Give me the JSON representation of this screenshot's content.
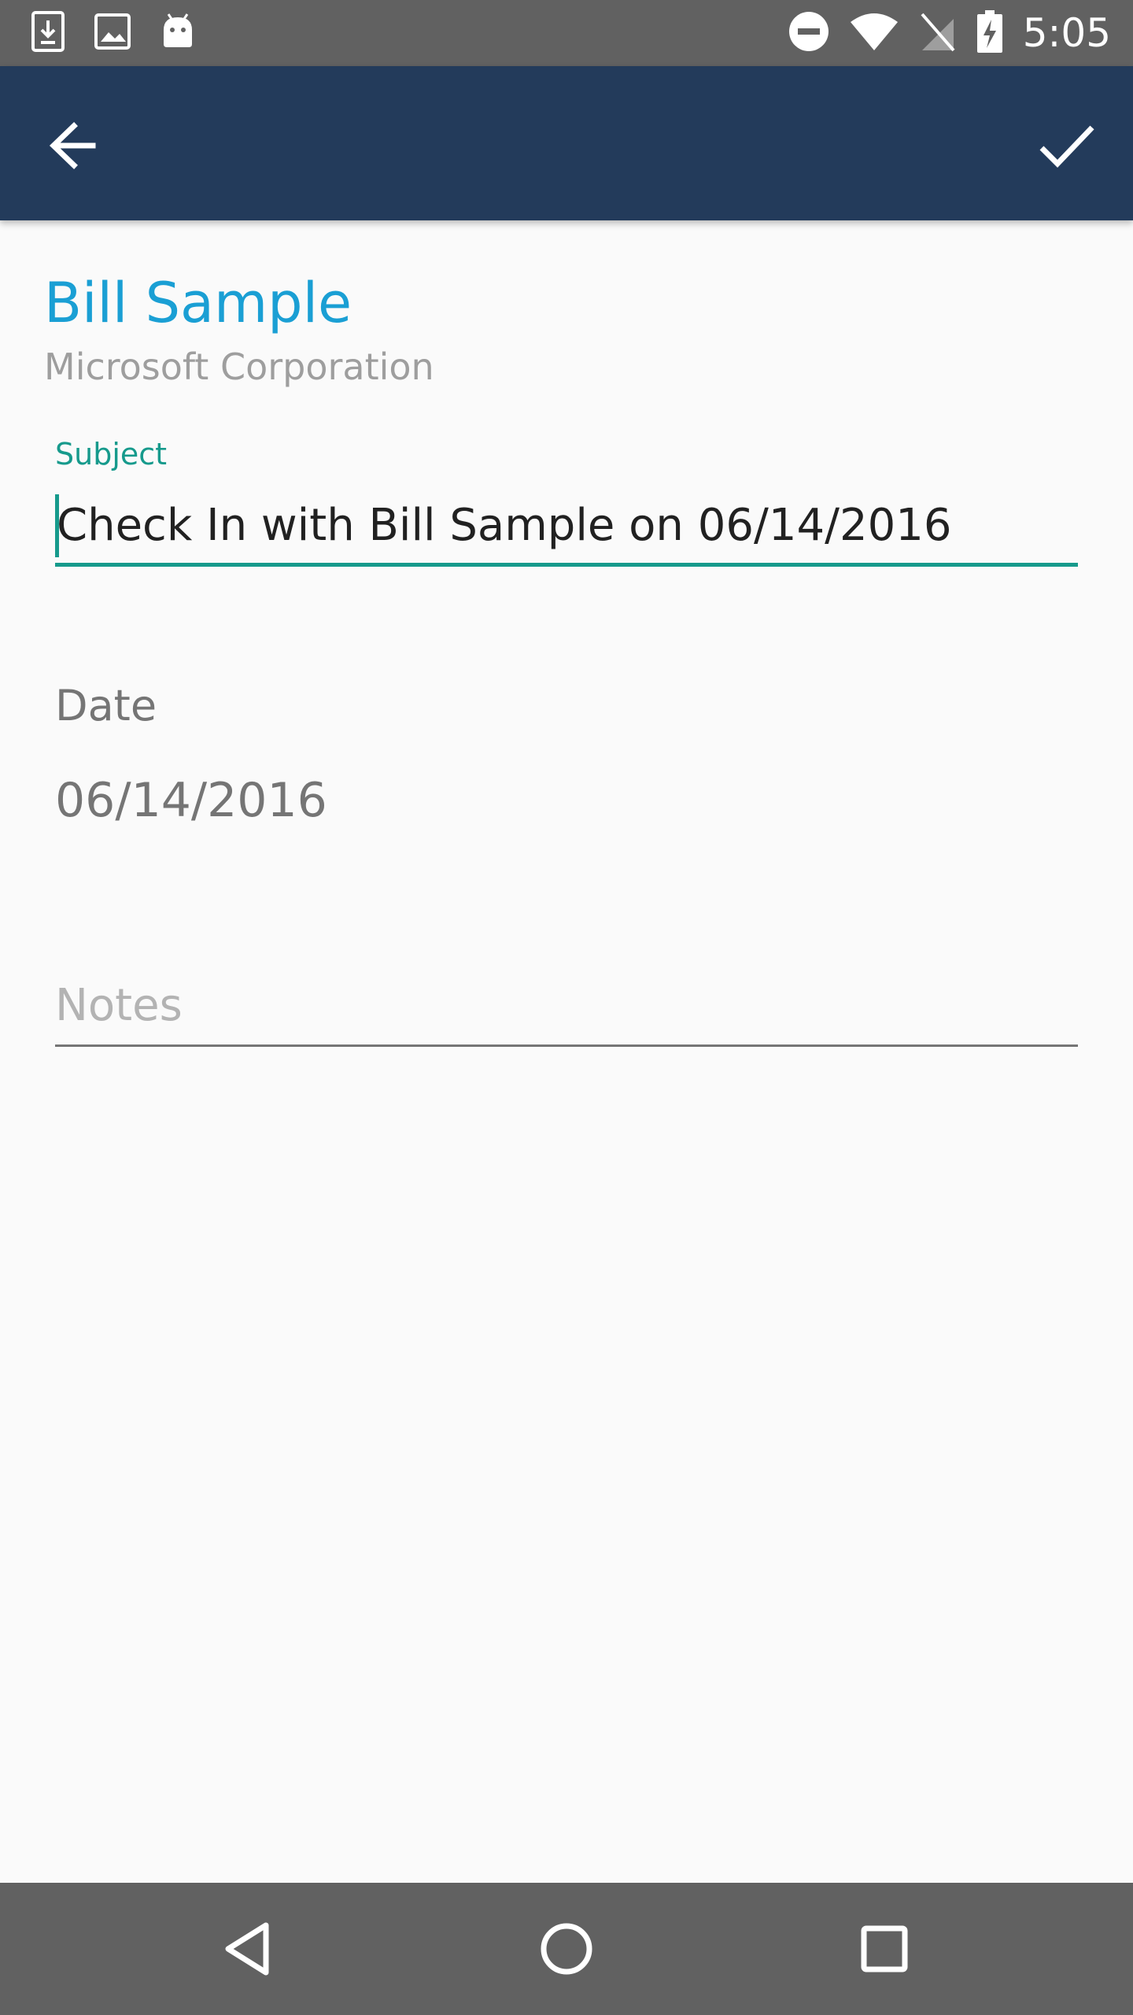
{
  "status_bar": {
    "time": "5:05",
    "icons_left": [
      "download-icon",
      "image-icon",
      "android-icon"
    ],
    "icons_right": [
      "do-not-disturb-icon",
      "wifi-icon",
      "no-sim-icon",
      "battery-charging-icon"
    ]
  },
  "toolbar": {
    "back_icon": "arrow-back-icon",
    "save_icon": "check-icon",
    "background": "#233b5b"
  },
  "contact": {
    "name": "Bill Sample",
    "company": "Microsoft Corporation",
    "name_color": "#1a9fd4"
  },
  "subject": {
    "label": "Subject",
    "value": "Check In with Bill Sample on 06/14/2016",
    "accent": "#169a8c"
  },
  "date": {
    "label": "Date",
    "value": "06/14/2016"
  },
  "notes": {
    "placeholder": "Notes"
  },
  "nav_bar": {
    "buttons": [
      "back-triangle-icon",
      "home-circle-icon",
      "recents-square-icon"
    ]
  }
}
